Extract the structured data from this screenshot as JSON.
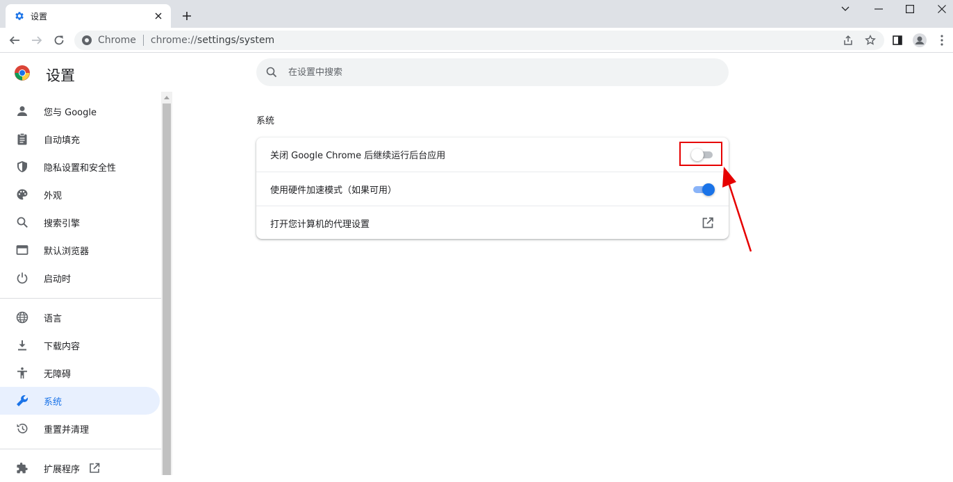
{
  "browser": {
    "tab": {
      "title": "设置",
      "favicon": "gear-icon"
    },
    "window_controls": [
      "chevron-down-icon",
      "minimize-icon",
      "maximize-icon",
      "close-icon"
    ],
    "address_bar": {
      "site_label": "Chrome",
      "url_scheme": "chrome://",
      "url_path": "settings/system"
    }
  },
  "settings": {
    "title": "设置",
    "search_placeholder": "在设置中搜索"
  },
  "sidebar": {
    "items": [
      {
        "label": "您与 Google",
        "icon": "person-icon"
      },
      {
        "label": "自动填充",
        "icon": "clipboard-icon"
      },
      {
        "label": "隐私设置和安全性",
        "icon": "shield-icon"
      },
      {
        "label": "外观",
        "icon": "palette-icon"
      },
      {
        "label": "搜索引擎",
        "icon": "search-icon"
      },
      {
        "label": "默认浏览器",
        "icon": "browser-window-icon"
      },
      {
        "label": "启动时",
        "icon": "power-icon"
      },
      {
        "label": "语言",
        "icon": "globe-icon"
      },
      {
        "label": "下载内容",
        "icon": "download-icon"
      },
      {
        "label": "无障碍",
        "icon": "accessibility-icon"
      },
      {
        "label": "系统",
        "icon": "wrench-icon",
        "active": true
      },
      {
        "label": "重置并清理",
        "icon": "reset-icon"
      },
      {
        "label": "扩展程序",
        "icon": "puzzle-icon"
      }
    ]
  },
  "main": {
    "section_title": "系统",
    "rows": [
      {
        "label": "关闭 Google Chrome 后继续运行后台应用",
        "control": "toggle",
        "enabled": false
      },
      {
        "label": "使用硬件加速模式（如果可用）",
        "control": "toggle",
        "enabled": true
      },
      {
        "label": "打开您计算机的代理设置",
        "control": "open-external-icon"
      }
    ]
  },
  "colors": {
    "accent": "#1a73e8",
    "active_nav_bg": "#e8f0fe",
    "annotation": "#e60000"
  }
}
